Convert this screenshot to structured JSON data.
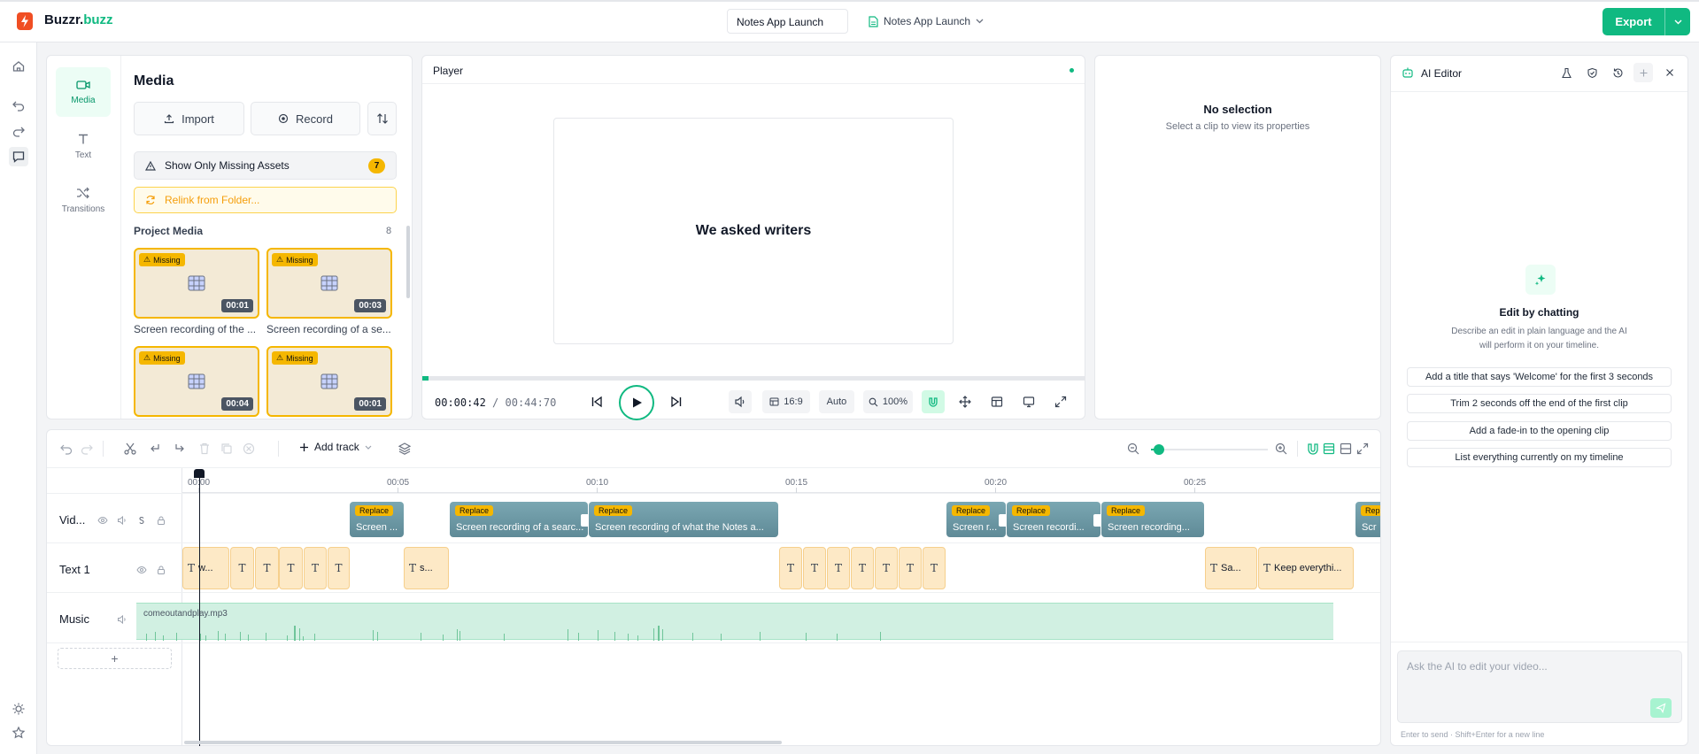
{
  "app": {
    "brand_main": "Buzzr.",
    "brand_accent": "buzz",
    "accent_color": "#10b981",
    "warning_color": "#f5b700"
  },
  "header": {
    "project_name": "Notes App Launch",
    "project_select": "Notes App Launch",
    "export_label": "Export"
  },
  "media": {
    "tabs": [
      {
        "label": "Media",
        "icon": "video-icon"
      },
      {
        "label": "Text",
        "icon": "text-icon"
      },
      {
        "label": "Transitions",
        "icon": "shuffle-icon"
      }
    ],
    "title": "Media",
    "import_label": "Import",
    "record_label": "Record",
    "missing_filter_label": "Show Only Missing Assets",
    "missing_count": "7",
    "relink_label": "Relink from Folder...",
    "project_media_title": "Project Media",
    "project_media_count": "8",
    "missing_badge": "Missing",
    "items": [
      {
        "duration": "00:01",
        "caption": "Screen recording of the ..."
      },
      {
        "duration": "00:03",
        "caption": "Screen recording of a se..."
      },
      {
        "duration": "00:04",
        "caption": ""
      },
      {
        "duration": "00:01",
        "caption": ""
      }
    ]
  },
  "player": {
    "title": "Player",
    "preview_text": "We asked writers",
    "current_time": "00:00:42",
    "separator": "/",
    "total_time": "00:44:70",
    "progress": 0.01,
    "aspect": "16:9",
    "quality": "Auto",
    "zoom": "100%"
  },
  "properties": {
    "title": "No selection",
    "subtitle": "Select a clip to view its properties"
  },
  "ai": {
    "title": "AI Editor",
    "heading": "Edit by chatting",
    "description": "Describe an edit in plain language and the AI will perform it on your timeline.",
    "suggestions": [
      "Add a title that says 'Welcome' for the first 3 seconds",
      "Trim 2 seconds off the end of the first clip",
      "Add a fade-in to the opening clip",
      "List everything currently on my timeline"
    ],
    "input_placeholder": "Ask the AI to edit your video...",
    "hint": "Enter to send · Shift+Enter for a new line"
  },
  "timeline": {
    "add_track_label": "Add track",
    "ruler": [
      "00:00",
      "00:05",
      "00:10",
      "00:15",
      "00:20",
      "00:25"
    ],
    "tracks": [
      {
        "name": "Vid..."
      },
      {
        "name": "Text 1"
      },
      {
        "name": "Music"
      }
    ],
    "add_row_label": "+",
    "replace_label": "Replace",
    "video_clips": [
      "Screen ...",
      "Screen recording of a searc...",
      "Screen recording of what the Notes a...",
      "Screen r...",
      "Screen recordi...",
      "Screen recording...",
      "Scre"
    ],
    "text_glyph": "T",
    "text_clip_labels": [
      "w...",
      "s...",
      "Sa...",
      "Keep everythi..."
    ],
    "music_clip": "comeoutandplay.mp3"
  }
}
